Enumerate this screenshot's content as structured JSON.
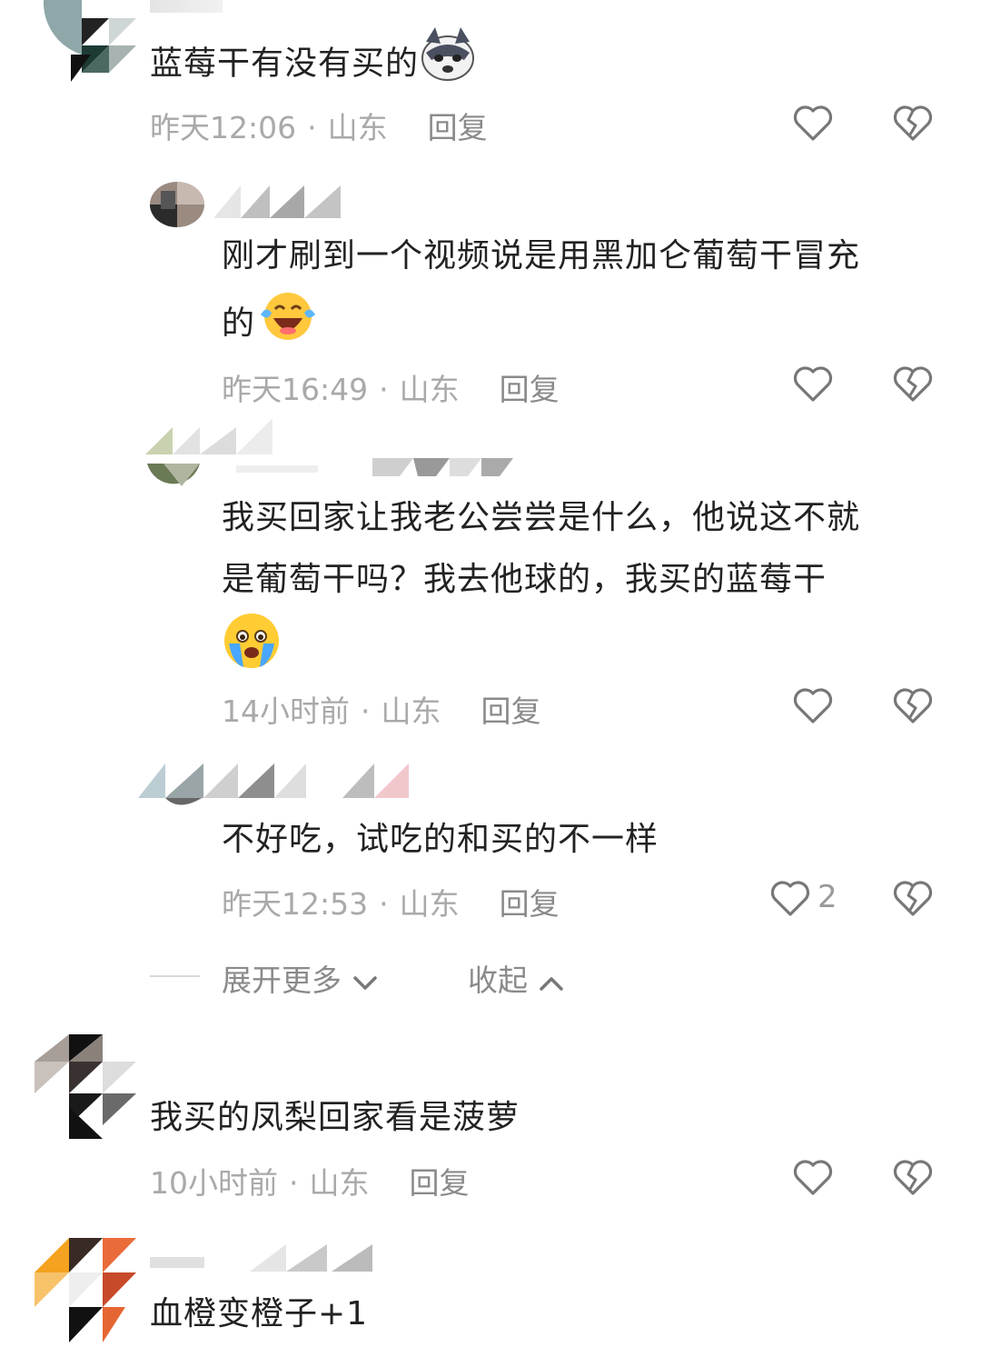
{
  "comments": [
    {
      "text": "蓝莓干有没有买的",
      "time": "昨天12:06",
      "location": "山东",
      "reply": "回复",
      "likes": ""
    },
    {
      "text_line1": "刚才刷到一个视频说是用黑加仑葡萄干冒充",
      "text_line2": "的",
      "time": "昨天16:49",
      "location": "山东",
      "reply": "回复",
      "likes": ""
    },
    {
      "text_line1": "我买回家让我老公尝尝是什么，他说这不就",
      "text_line2": "是葡萄干吗？我去他球的，我买的蓝莓干",
      "time": "14小时前",
      "location": "山东",
      "reply": "回复",
      "likes": ""
    },
    {
      "text": "不好吃，试吃的和买的不一样",
      "time": "昨天12:53",
      "location": "山东",
      "reply": "回复",
      "likes": "2"
    },
    {
      "text": "我买的凤梨回家看是菠萝",
      "time": "10小时前",
      "location": "山东",
      "reply": "回复",
      "likes": ""
    },
    {
      "text": "血橙变橙子+1"
    }
  ],
  "thread_controls": {
    "expand_more": "展开更多",
    "collapse": "收起"
  },
  "separator": "·",
  "colors": {
    "text": "#222222",
    "meta": "#a9a9a9",
    "reply": "#8a8a8a",
    "icon": "#777777"
  }
}
